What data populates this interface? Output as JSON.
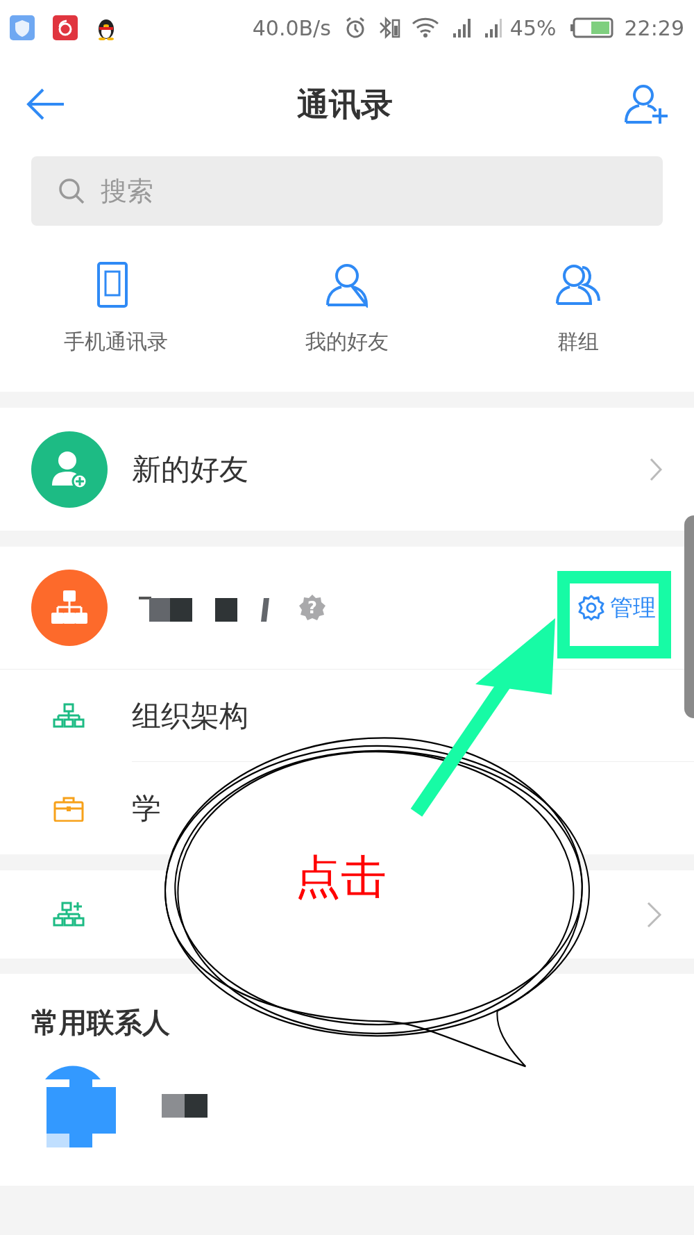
{
  "status_bar": {
    "net_speed": "40.0B/s",
    "battery_percent": "45%",
    "time": "22:29"
  },
  "header": {
    "title": "通讯录"
  },
  "search": {
    "placeholder": "搜索"
  },
  "quick_links": [
    {
      "kind": "phone",
      "label": "手机通讯录"
    },
    {
      "kind": "person",
      "label": "我的好友"
    },
    {
      "kind": "group",
      "label": "群组"
    }
  ],
  "new_friends": {
    "label": "新的好友"
  },
  "organization": {
    "badge": "?",
    "manage": "管理",
    "items": [
      {
        "kind": "org",
        "label": "组织架构"
      },
      {
        "kind": "case",
        "label": "学"
      }
    ]
  },
  "create_org": {
    "kind": "add-org"
  },
  "frequent": {
    "heading": "常用联系人"
  },
  "annotation": {
    "text": "点击"
  }
}
